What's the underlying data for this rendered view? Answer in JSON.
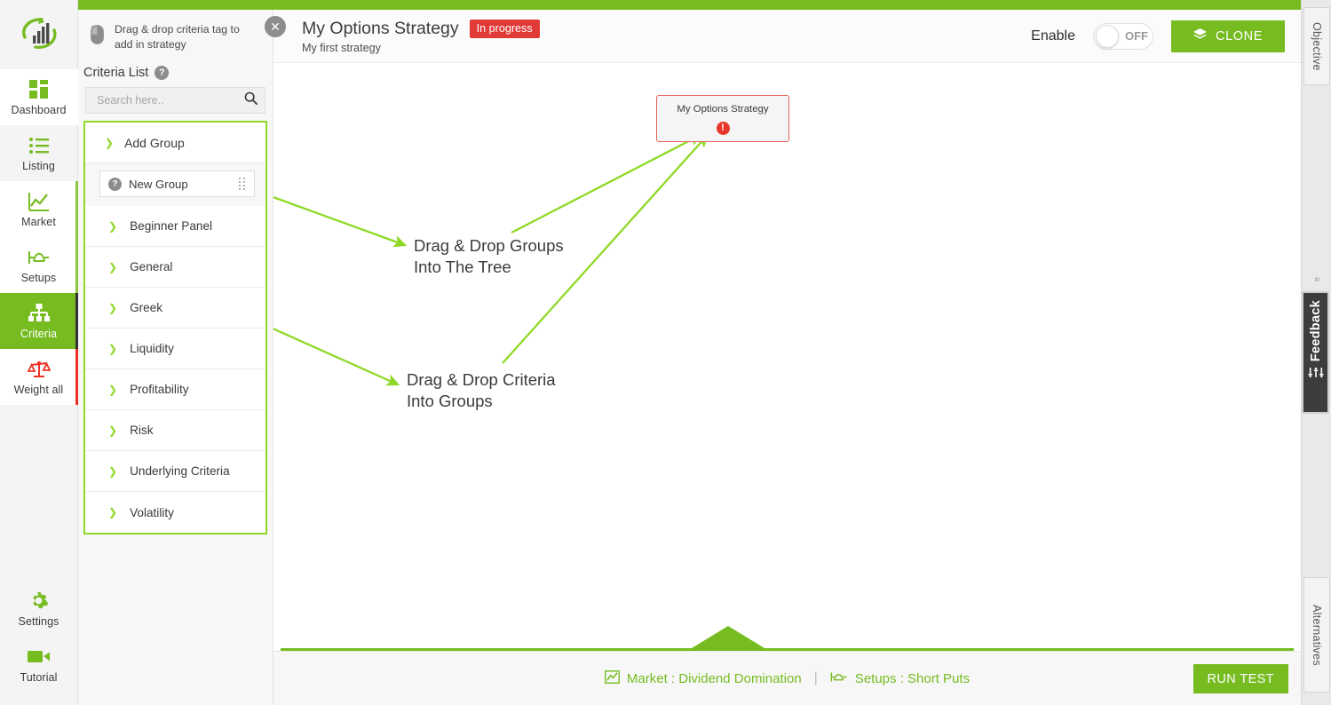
{
  "theme": {
    "green": "#76bc21",
    "bright_green": "#8ed926",
    "red": "#e13a37",
    "dark": "#3a3a3a"
  },
  "sidebar": {
    "logo_name": "logo-bars-swoosh",
    "items": [
      {
        "label": "Dashboard",
        "icon": "grid-icon",
        "active": false,
        "edge": "none"
      },
      {
        "label": "Listing",
        "icon": "list-icon",
        "active": false,
        "edge": "none"
      },
      {
        "label": "Market",
        "icon": "line-chart-icon",
        "active": false,
        "edge": "green"
      },
      {
        "label": "Setups",
        "icon": "setups-icon",
        "active": false,
        "edge": "green"
      },
      {
        "label": "Criteria",
        "icon": "tree-icon",
        "active": true,
        "edge": "dark"
      },
      {
        "label": "Weight all",
        "icon": "scales-icon",
        "active": false,
        "edge": "red"
      }
    ],
    "bottom_items": [
      {
        "label": "Settings",
        "icon": "gear-icon"
      },
      {
        "label": "Tutorial",
        "icon": "video-camera-icon"
      }
    ]
  },
  "criteria_panel": {
    "drag_hint": "Drag & drop criteria tag to add in strategy",
    "drag_hint_icon": "mouse-icon",
    "close_icon": "close-icon",
    "list_title": "Criteria List",
    "help_icon": "question-mark-icon",
    "search": {
      "value": "",
      "placeholder": "Search here..",
      "icon": "search-icon"
    },
    "add_group": {
      "label": "Add Group",
      "chevron": "chevron-down-icon",
      "item": {
        "label": "New Group",
        "help_icon": "question-mark-icon",
        "handle_icon": "drag-handle-icon"
      }
    },
    "categories": [
      {
        "label": "Beginner Panel"
      },
      {
        "label": "General"
      },
      {
        "label": "Greek"
      },
      {
        "label": "Liquidity"
      },
      {
        "label": "Profitability"
      },
      {
        "label": "Risk"
      },
      {
        "label": "Underlying Criteria"
      },
      {
        "label": "Volatility"
      }
    ]
  },
  "header": {
    "title": "My Options Strategy",
    "status_badge": "In progress",
    "subtitle": "My first strategy",
    "enable_label": "Enable",
    "toggle_state": "OFF",
    "clone_button": "CLONE",
    "clone_icon": "layers-icon"
  },
  "canvas": {
    "node": {
      "title": "My Options Strategy",
      "warning_icon": "exclamation-icon"
    },
    "annotations": [
      {
        "text": "Drag & Drop Groups\nInto The Tree"
      },
      {
        "text": "Drag & Drop Criteria\nInto Groups"
      }
    ]
  },
  "footer": {
    "links": [
      {
        "label": "Market : Dividend Domination",
        "icon": "line-chart-icon"
      },
      {
        "label": "Setups : Short Puts",
        "icon": "setups-icon"
      }
    ],
    "separator": "|",
    "run_test_button": "RUN TEST"
  },
  "rail": {
    "objective_tab": "Objective",
    "alternatives_tab": "Alternatives",
    "feedback_tab": "Feedback",
    "feedback_icon": "sliders-icon"
  }
}
